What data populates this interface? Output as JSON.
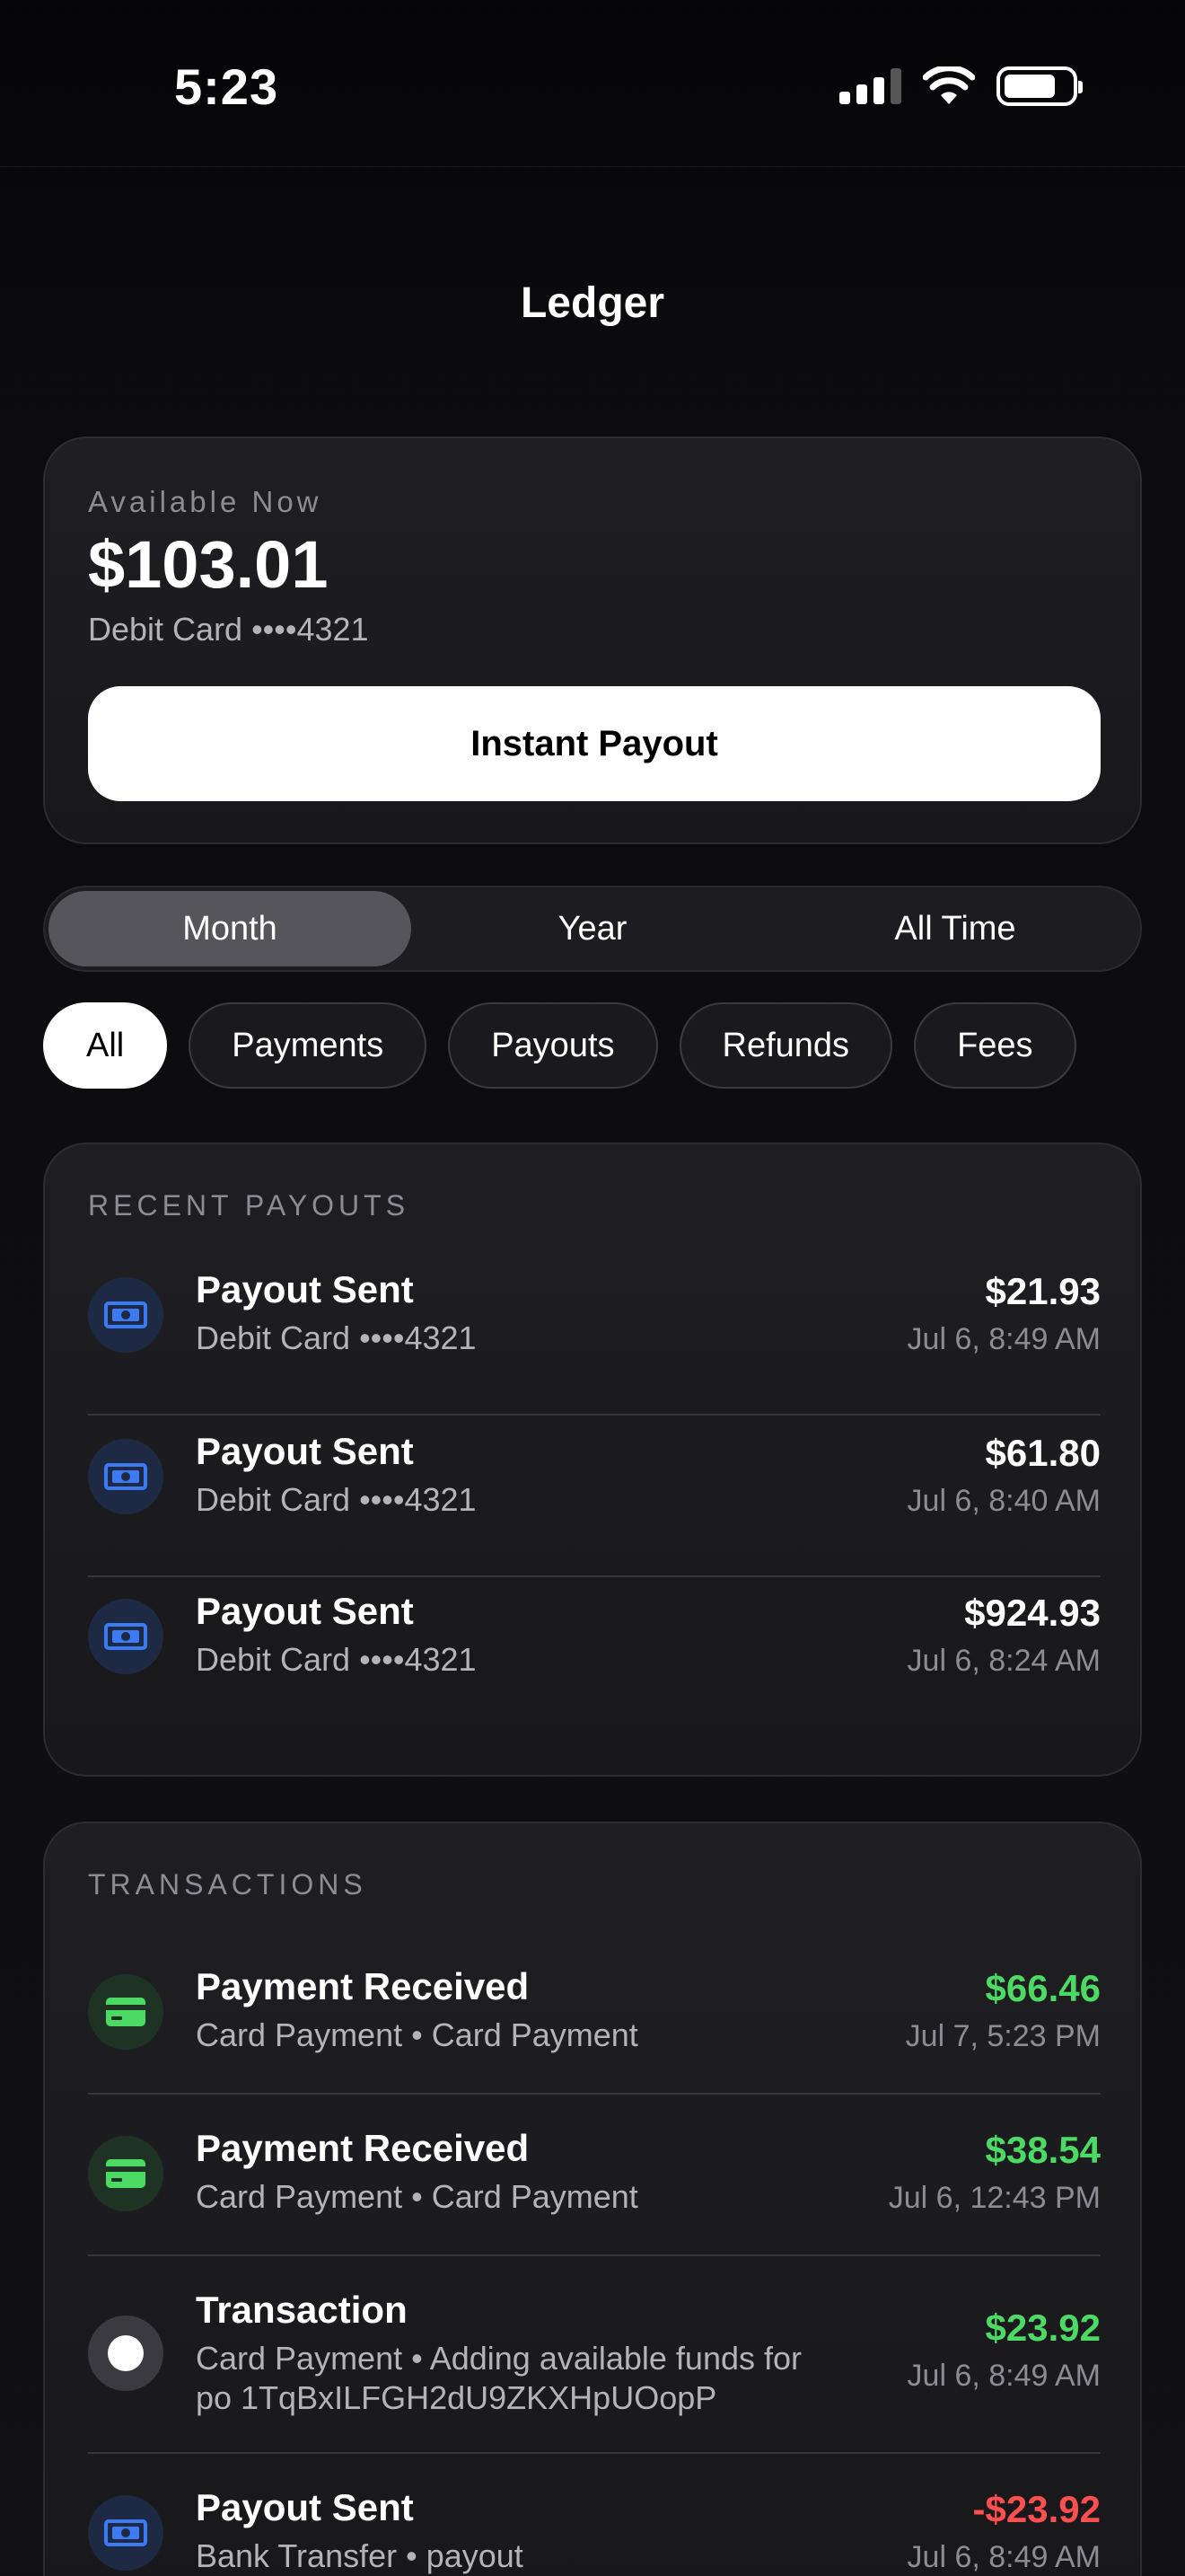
{
  "status": {
    "time": "5:23"
  },
  "nav": {
    "title": "Ledger"
  },
  "balance": {
    "label": "Available Now",
    "amount": "$103.01",
    "account": "Debit Card ••••4321",
    "button": "Instant Payout"
  },
  "periods": [
    "Month",
    "Year",
    "All Time"
  ],
  "active_period": "Month",
  "filters": [
    "All",
    "Payments",
    "Payouts",
    "Refunds",
    "Fees"
  ],
  "active_filter": "All",
  "recent_payouts": {
    "title": "RECENT PAYOUTS",
    "items": [
      {
        "title": "Payout Sent",
        "sub": "Debit Card ••••4321",
        "amount": "$21.93",
        "date": "Jul 6, 8:49 AM"
      },
      {
        "title": "Payout Sent",
        "sub": "Debit Card ••••4321",
        "amount": "$61.80",
        "date": "Jul 6, 8:40 AM"
      },
      {
        "title": "Payout Sent",
        "sub": "Debit Card ••••4321",
        "amount": "$924.93",
        "date": "Jul 6, 8:24 AM"
      }
    ]
  },
  "transactions": {
    "title": "TRANSACTIONS",
    "items": [
      {
        "title": "Payment Received",
        "sub": "Card Payment • Card Payment",
        "amount": "$66.46",
        "date": "Jul 7, 5:23 PM",
        "icon": "card-icon",
        "tone": "positive"
      },
      {
        "title": "Payment Received",
        "sub": "Card Payment • Card Payment",
        "amount": "$38.54",
        "date": "Jul 6, 12:43 PM",
        "icon": "card-icon",
        "tone": "positive"
      },
      {
        "title": "Transaction",
        "sub": "Card Payment • Adding available funds for po 1TqBxILFGH2dU9ZKXHpUOopP",
        "amount": "$23.92",
        "date": "Jul 6, 8:49 AM",
        "icon": "circle-icon",
        "tone": "positive"
      },
      {
        "title": "Payout Sent",
        "sub": "Bank Transfer • payout",
        "amount": "-$23.92",
        "date": "Jul 6, 8:49 AM",
        "icon": "banknote-icon",
        "tone": "negative"
      }
    ]
  },
  "colors": {
    "positive": "#4cd964",
    "negative": "#ff4f4f",
    "payout_icon": "#3d7bf5",
    "accent_bg": "#ffffff"
  }
}
